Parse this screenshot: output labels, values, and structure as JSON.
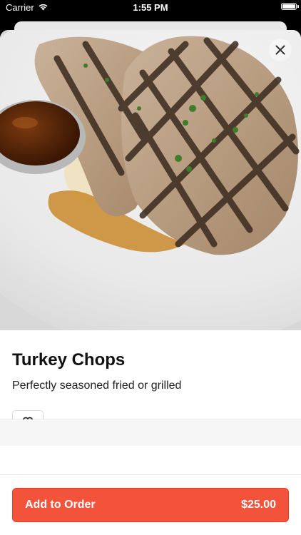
{
  "status_bar": {
    "carrier": "Carrier",
    "time": "1:55 PM"
  },
  "item": {
    "title": "Turkey Chops",
    "description": "Perfectly seasoned fried or grilled"
  },
  "order_button": {
    "label": "Add to Order",
    "price": "$25.00"
  },
  "colors": {
    "accent": "#f4533b"
  },
  "icons": {
    "close": "close-icon",
    "favorite": "heart-icon",
    "wifi": "wifi-icon",
    "battery": "battery-icon"
  }
}
